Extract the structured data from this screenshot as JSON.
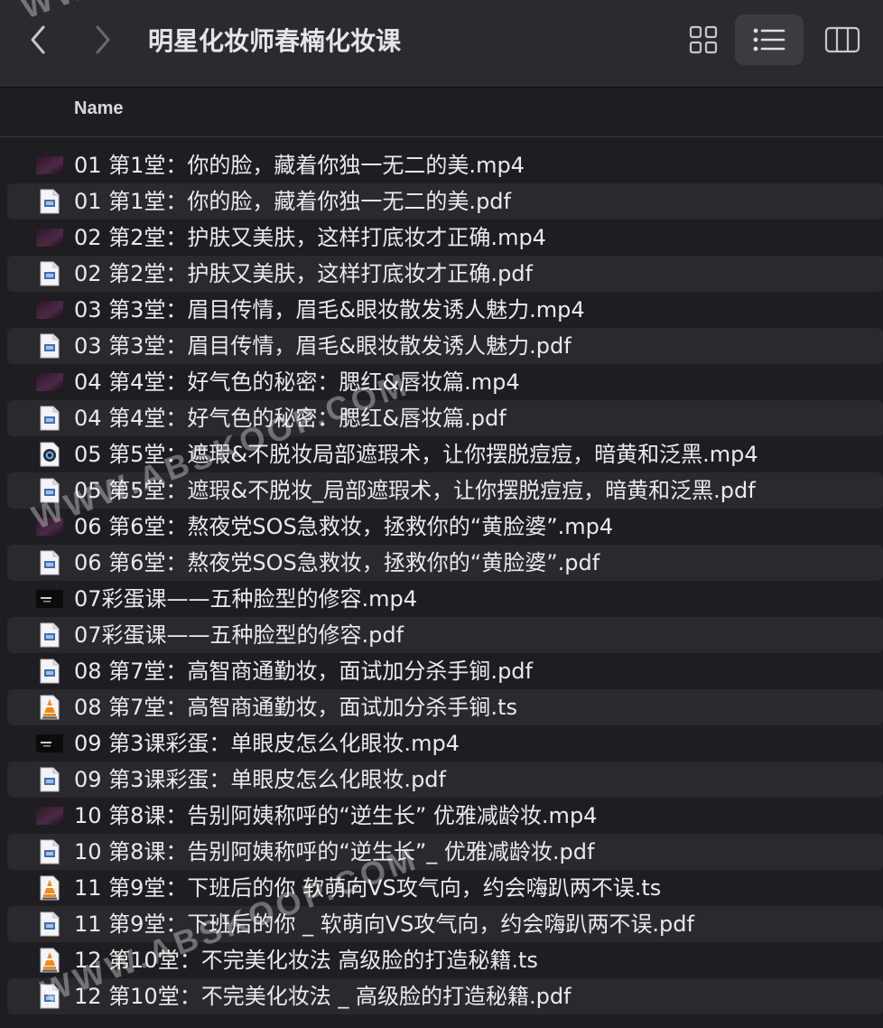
{
  "window": {
    "title": "明星化妆师春楠化妆课"
  },
  "header": {
    "name_col": "Name"
  },
  "watermark": {
    "text": "WWW.ABSKOOP.COM"
  },
  "files": [
    {
      "name": "01 第1堂：你的脸，藏着你独一无二的美.mp4",
      "type": "video"
    },
    {
      "name": "01 第1堂：你的脸，藏着你独一无二的美.pdf",
      "type": "pdf"
    },
    {
      "name": "02 第2堂：护肤又美肤，这样打底妆才正确.mp4",
      "type": "video"
    },
    {
      "name": "02 第2堂：护肤又美肤，这样打底妆才正确.pdf",
      "type": "pdf"
    },
    {
      "name": "03 第3堂：眉目传情，眉毛&眼妆散发诱人魅力.mp4",
      "type": "video"
    },
    {
      "name": "03 第3堂：眉目传情，眉毛&眼妆散发诱人魅力.pdf",
      "type": "pdf"
    },
    {
      "name": "04 第4堂：好气色的秘密：腮红&唇妆篇.mp4",
      "type": "video"
    },
    {
      "name": "04 第4堂：好气色的秘密：腮红&唇妆篇.pdf",
      "type": "pdf"
    },
    {
      "name": "05 第5堂：遮瑕&不脱妆局部遮瑕术，让你摆脱痘痘，暗黄和泛黑.mp4",
      "type": "quicktime"
    },
    {
      "name": "05 第5堂：遮瑕&不脱妆_局部遮瑕术，让你摆脱痘痘，暗黄和泛黑.pdf",
      "type": "pdf"
    },
    {
      "name": "06 第6堂：熬夜党SOS急救妆，拯救你的“黄脸婆”.mp4",
      "type": "video"
    },
    {
      "name": "06 第6堂：熬夜党SOS急救妆，拯救你的“黄脸婆”.pdf",
      "type": "pdf"
    },
    {
      "name": "07彩蛋课——五种脸型的修容.mp4",
      "type": "video-dark"
    },
    {
      "name": "07彩蛋课——五种脸型的修容.pdf",
      "type": "pdf"
    },
    {
      "name": "08 第7堂：高智商通勤妆，面试加分杀手锏.pdf",
      "type": "pdf"
    },
    {
      "name": "08 第7堂：高智商通勤妆，面试加分杀手锏.ts",
      "type": "ts"
    },
    {
      "name": "09 第3课彩蛋：单眼皮怎么化眼妆.mp4",
      "type": "video-dark"
    },
    {
      "name": "09 第3课彩蛋：单眼皮怎么化眼妆.pdf",
      "type": "pdf"
    },
    {
      "name": "10 第8课：告别阿姨称呼的“逆生长” 优雅减龄妆.mp4",
      "type": "video"
    },
    {
      "name": "10 第8课：告别阿姨称呼的“逆生长”_ 优雅减龄妆.pdf",
      "type": "pdf"
    },
    {
      "name": "11 第9堂：下班后的你  软萌向VS攻气向，约会嗨趴两不误.ts",
      "type": "ts"
    },
    {
      "name": "11 第9堂：下班后的你 _ 软萌向VS攻气向，约会嗨趴两不误.pdf",
      "type": "pdf"
    },
    {
      "name": "12 第10堂：不完美化妆法  高级脸的打造秘籍.ts",
      "type": "ts"
    },
    {
      "name": "12 第10堂：不完美化妆法 _ 高级脸的打造秘籍.pdf",
      "type": "pdf"
    }
  ]
}
